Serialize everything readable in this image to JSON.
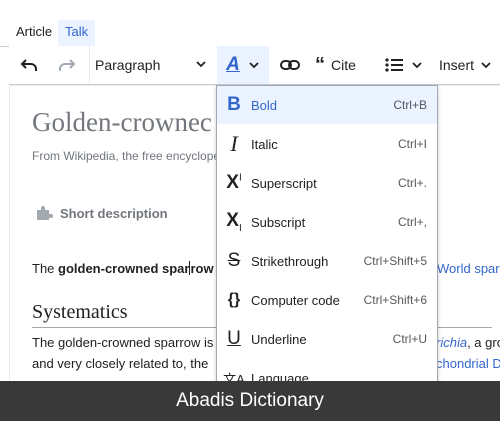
{
  "tabs": {
    "article": "Article",
    "talk": "Talk"
  },
  "toolbar": {
    "paragraph": "Paragraph",
    "style_icon": "A",
    "cite": "Cite",
    "insert": "Insert"
  },
  "page": {
    "title": "Golden-crownec",
    "from": "From Wikipedia, the free encyclope",
    "short_description": "Short description",
    "lead_prefix": "The ",
    "lead_bold_a": "golden-crowned spar",
    "lead_bold_b": "row",
    "lead_right": "World spar",
    "heading": "Systematics",
    "p1_left": "The golden-crowned sparrow is",
    "p1_right_link": "richia",
    "p1_right_text": ", a gro",
    "p2_left": "and very closely related to, the ",
    "p2_right": "chondrial D"
  },
  "menu": [
    {
      "icon": "B",
      "label": "Bold",
      "shortcut": "Ctrl+B"
    },
    {
      "icon": "I",
      "label": "Italic",
      "shortcut": "Ctrl+I"
    },
    {
      "icon": "X",
      "label": "Superscript",
      "shortcut": "Ctrl+."
    },
    {
      "icon": "X",
      "label": "Subscript",
      "shortcut": "Ctrl+,"
    },
    {
      "icon": "S",
      "label": "Strikethrough",
      "shortcut": "Ctrl+Shift+5"
    },
    {
      "icon": "{}",
      "label": "Computer code",
      "shortcut": "Ctrl+Shift+6"
    },
    {
      "icon": "U",
      "label": "Underline",
      "shortcut": "Ctrl+U"
    },
    {
      "icon": "文A",
      "label": "Language",
      "shortcut": ""
    }
  ],
  "footer": {
    "text": "Abadis Dictionary"
  },
  "colors": {
    "link": "#3366cc",
    "active_bg": "#eaf3ff",
    "footer_bg": "#393939"
  }
}
